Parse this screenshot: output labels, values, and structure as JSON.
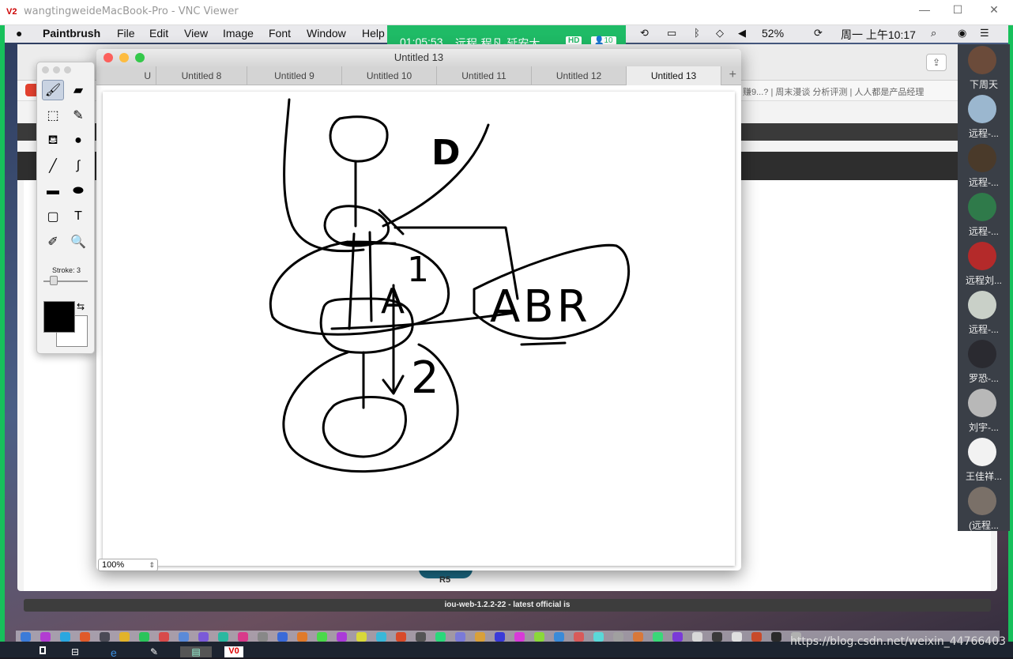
{
  "vnc": {
    "title": "wangtingweideMacBook-Pro - VNC Viewer",
    "icon_text": "V2",
    "min": "—",
    "max": "☐",
    "close": "✕"
  },
  "mac_menu": {
    "items": [
      "Paintbrush",
      "File",
      "Edit",
      "View",
      "Image",
      "Font",
      "Window",
      "Help"
    ],
    "battery": "52%",
    "clock": "周一 上午10:17"
  },
  "meeting": {
    "time": "01:05:53",
    "name": "远程-程凡-延安大...",
    "hd": "HD",
    "count": "10"
  },
  "browser": {
    "bookmarks": "赚9...?  |  周末漫谈      分析评测  |  人人都是产品经理",
    "r5": "R5",
    "status": "iou-web-1.2.2-22 - latest official is"
  },
  "app": {
    "title": "Untitled 13",
    "tabs": [
      {
        "label": "U"
      },
      {
        "label": "Untitled 8"
      },
      {
        "label": "Untitled 9"
      },
      {
        "label": "Untitled 10"
      },
      {
        "label": "Untitled 11"
      },
      {
        "label": "Untitled 12"
      },
      {
        "label": "Untitled 13"
      }
    ],
    "zoom": "100%",
    "stroke_label": "Stroke: 3",
    "drawing_text": {
      "d": "D",
      "one": "1",
      "a": "A",
      "abr": "ABR",
      "two": "2"
    }
  },
  "tools": [
    {
      "name": "paintbrush-icon",
      "glyph": "🖌"
    },
    {
      "name": "eraser-icon",
      "glyph": "▰"
    },
    {
      "name": "rect-select-icon",
      "glyph": "⬚"
    },
    {
      "name": "magic-wand-icon",
      "glyph": "✎"
    },
    {
      "name": "paint-bucket-icon",
      "glyph": "⛾"
    },
    {
      "name": "bomb-icon",
      "glyph": "●"
    },
    {
      "name": "line-icon",
      "glyph": "╱"
    },
    {
      "name": "curve-icon",
      "glyph": "∫"
    },
    {
      "name": "rectangle-icon",
      "glyph": "▬"
    },
    {
      "name": "ellipse-icon",
      "glyph": "⬬"
    },
    {
      "name": "rounded-rect-icon",
      "glyph": "▢"
    },
    {
      "name": "text-icon",
      "glyph": "T"
    },
    {
      "name": "eyedropper-icon",
      "glyph": "✐"
    },
    {
      "name": "magnifier-icon",
      "glyph": "🔍"
    }
  ],
  "participants": [
    {
      "name": "下周天",
      "color": "#6b4b3a"
    },
    {
      "name": "远程-...",
      "color": "#9bb7cf"
    },
    {
      "name": "远程-...",
      "color": "#4a3a2a"
    },
    {
      "name": "远程-...",
      "color": "#2f7a4a"
    },
    {
      "name": "远程刘...",
      "color": "#b42a2a"
    },
    {
      "name": "远程-...",
      "color": "#c9d0c8"
    },
    {
      "name": "罗恐-...",
      "color": "#2a2a30"
    },
    {
      "name": "刘宇-...",
      "color": "#b8b8b8"
    },
    {
      "name": "王佳祥...",
      "color": "#f2f2f2"
    },
    {
      "name": "(远程...",
      "color": "#7a7068"
    }
  ],
  "watermark": "https://blog.csdn.net/weixin_44766403",
  "colors": {
    "vnc_green": "#17c05b",
    "meeting_green": "#1fbb66",
    "ink": "#000000"
  }
}
